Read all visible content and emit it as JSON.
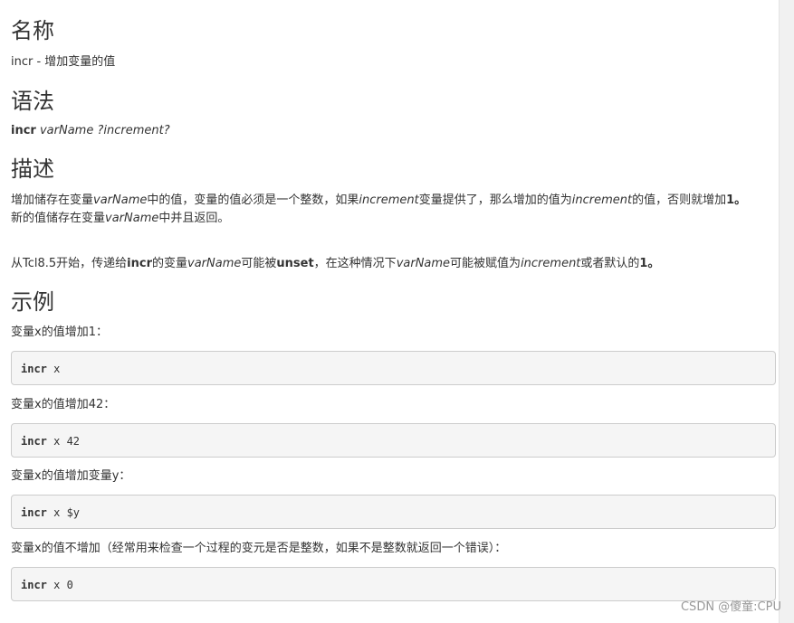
{
  "sections": {
    "name_heading": "名称",
    "name_text": "incr - 增加变量的值",
    "syntax_heading": "语法",
    "syntax_cmd": "incr",
    "syntax_arg1": "varName",
    "syntax_arg2": "?increment?",
    "desc_heading": "描述",
    "desc_p1_a": "增加储存在变量",
    "desc_p1_var": "varName",
    "desc_p1_b": "中的值，变量的值必须是一个整数，如果",
    "desc_p1_inc": "increment",
    "desc_p1_c": "变量提供了，那么增加的值为",
    "desc_p1_inc2": "increment",
    "desc_p1_d": "的值，否则就增加",
    "desc_p1_one": "1。",
    "desc_p1_line2_a": "新的值储存在变量",
    "desc_p1_line2_var": "varName",
    "desc_p1_line2_b": "中并且返回。",
    "desc_p2_a": "从Tcl8.5开始，传递给",
    "desc_p2_incr": "incr",
    "desc_p2_b": "的变量",
    "desc_p2_var": "varName",
    "desc_p2_c": "可能被",
    "desc_p2_unset": "unset",
    "desc_p2_d": "，在这种情况下",
    "desc_p2_var2": "varName",
    "desc_p2_e": "可能被赋值为",
    "desc_p2_inc": "increment",
    "desc_p2_f": "或者默认的",
    "desc_p2_one": "1。",
    "examples_heading": "示例"
  },
  "examples": [
    {
      "caption": "变量x的值增加1：",
      "cmd": "incr",
      "args": " x"
    },
    {
      "caption": "变量x的值增加42：",
      "cmd": "incr",
      "args": " x 42"
    },
    {
      "caption": "变量x的值增加变量y：",
      "cmd": "incr",
      "args": " x $y"
    },
    {
      "caption": "变量x的值不增加（经常用来检查一个过程的变元是否是整数，如果不是整数就返回一个错误）：",
      "cmd": "incr",
      "args": " x 0"
    }
  ],
  "watermark": "CSDN @傻童:CPU"
}
